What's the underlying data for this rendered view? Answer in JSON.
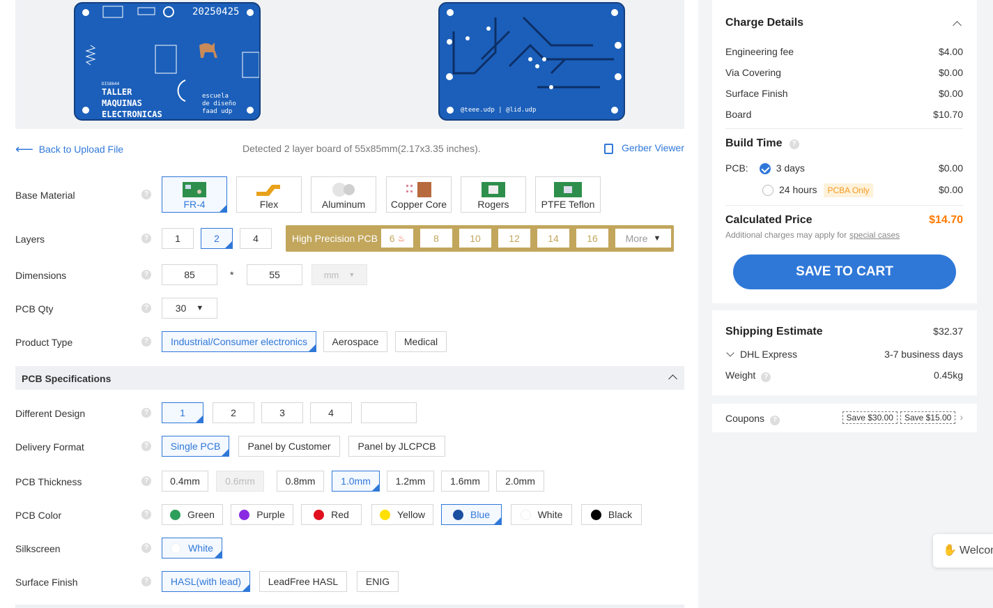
{
  "board": {
    "top_text1": "20250425",
    "top_text2": "TALLER",
    "top_text3": "MAQUINAS",
    "top_text4": "ELECTRONICAS",
    "top_text5": "escuela",
    "top_text6": "de diseño",
    "top_text7": "faad udp",
    "top_small": "DIS8644",
    "bottom_text": "@teee.udp | @lid.udp"
  },
  "nav": {
    "back_label": "Back to Upload File",
    "detected": "Detected 2 layer board of 55x85mm(2.17x3.35 inches).",
    "gerber_label": "Gerber Viewer"
  },
  "base_material": {
    "label": "Base Material",
    "options": [
      "FR-4",
      "Flex",
      "Aluminum",
      "Copper Core",
      "Rogers",
      "PTFE Teflon"
    ],
    "selected": "FR-4"
  },
  "layers": {
    "label": "Layers",
    "options": [
      "1",
      "2",
      "4"
    ],
    "selected": "2",
    "hp_label": "High Precision PCB",
    "hp_options": [
      "6",
      "8",
      "10",
      "12",
      "14",
      "16"
    ],
    "more": "More"
  },
  "dimensions": {
    "label": "Dimensions",
    "width": "85",
    "height": "55",
    "sep": "*",
    "unit": "mm"
  },
  "qty": {
    "label": "PCB Qty",
    "value": "30"
  },
  "product_type": {
    "label": "Product Type",
    "options": [
      "Industrial/Consumer electronics",
      "Aerospace",
      "Medical"
    ],
    "selected": "Industrial/Consumer electronics"
  },
  "spec_section": {
    "title": "PCB Specifications"
  },
  "different_design": {
    "label": "Different Design",
    "options": [
      "1",
      "2",
      "3",
      "4",
      ""
    ],
    "selected": "1"
  },
  "delivery_format": {
    "label": "Delivery Format",
    "options": [
      "Single PCB",
      "Panel by Customer",
      "Panel by JLCPCB"
    ],
    "selected": "Single PCB"
  },
  "thickness": {
    "label": "PCB Thickness",
    "options": [
      "0.4mm",
      "0.6mm",
      "0.8mm",
      "1.0mm",
      "1.2mm",
      "1.6mm",
      "2.0mm"
    ],
    "selected": "1.0mm",
    "disabled": "0.6mm"
  },
  "color": {
    "label": "PCB Color",
    "options": [
      "Green",
      "Purple",
      "Red",
      "Yellow",
      "Blue",
      "White",
      "Black"
    ],
    "selected": "Blue",
    "swatches": [
      "#2e9e5b",
      "#8a2be2",
      "#e0101e",
      "#ffe000",
      "#1b4fa0",
      "#ffffff",
      "#000000"
    ]
  },
  "silkscreen": {
    "label": "Silkscreen",
    "value": "White"
  },
  "surface_finish": {
    "label": "Surface Finish",
    "options": [
      "HASL(with lead)",
      "LeadFree HASL",
      "ENIG"
    ],
    "selected": "HASL(with lead)"
  },
  "charge": {
    "title": "Charge Details",
    "rows": [
      {
        "name": "Engineering fee",
        "value": "$4.00"
      },
      {
        "name": "Via Covering",
        "value": "$0.00"
      },
      {
        "name": "Surface Finish",
        "value": "$0.00"
      },
      {
        "name": "Board",
        "value": "$10.70"
      }
    ]
  },
  "build_time": {
    "title": "Build Time",
    "pcb_label": "PCB:",
    "opt1": "3 days",
    "opt1_price": "$0.00",
    "opt2": "24 hours",
    "opt2_price": "$0.00",
    "pcba_only": "PCBA Only"
  },
  "calc": {
    "title": "Calculated Price",
    "value": "$14.70",
    "note": "Additional charges may apply for",
    "note_link": "special cases"
  },
  "cart_button": "SAVE TO CART",
  "shipping": {
    "title": "Shipping Estimate",
    "value": "$32.37",
    "carrier": "DHL Express",
    "days": "3-7 business days",
    "weight_label": "Weight",
    "weight": "0.45kg"
  },
  "coupons": {
    "label": "Coupons",
    "c1": "Save $30.00",
    "c2": "Save $15.00"
  },
  "chat": {
    "label": "Welcom"
  },
  "colors": {
    "accent": "#2f78d8",
    "price": "#ff7a00",
    "gold": "#c2a65c"
  }
}
